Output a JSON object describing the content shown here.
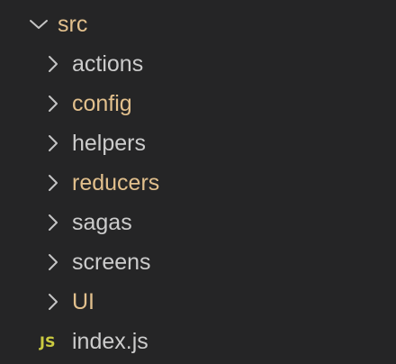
{
  "explorer": {
    "root": {
      "name": "src",
      "expanded": true,
      "icon": "chevron-down-icon"
    },
    "folders": [
      {
        "name": "actions",
        "status": "plain",
        "icon": "chevron-right-icon"
      },
      {
        "name": "config",
        "status": "modified",
        "icon": "chevron-right-icon"
      },
      {
        "name": "helpers",
        "status": "plain",
        "icon": "chevron-right-icon"
      },
      {
        "name": "reducers",
        "status": "modified",
        "icon": "chevron-right-icon"
      },
      {
        "name": "sagas",
        "status": "plain",
        "icon": "chevron-right-icon"
      },
      {
        "name": "screens",
        "status": "plain",
        "icon": "chevron-right-icon"
      },
      {
        "name": "UI",
        "status": "modified",
        "icon": "chevron-right-icon"
      }
    ],
    "file": {
      "name": "index.js",
      "badge": "JS",
      "icon": "javascript-file-icon"
    }
  },
  "colors": {
    "background": "#252526",
    "text": "#cccccc",
    "modified": "#e2c08d",
    "js_badge": "#cbcb41",
    "chevron": "#c5c5c5"
  }
}
